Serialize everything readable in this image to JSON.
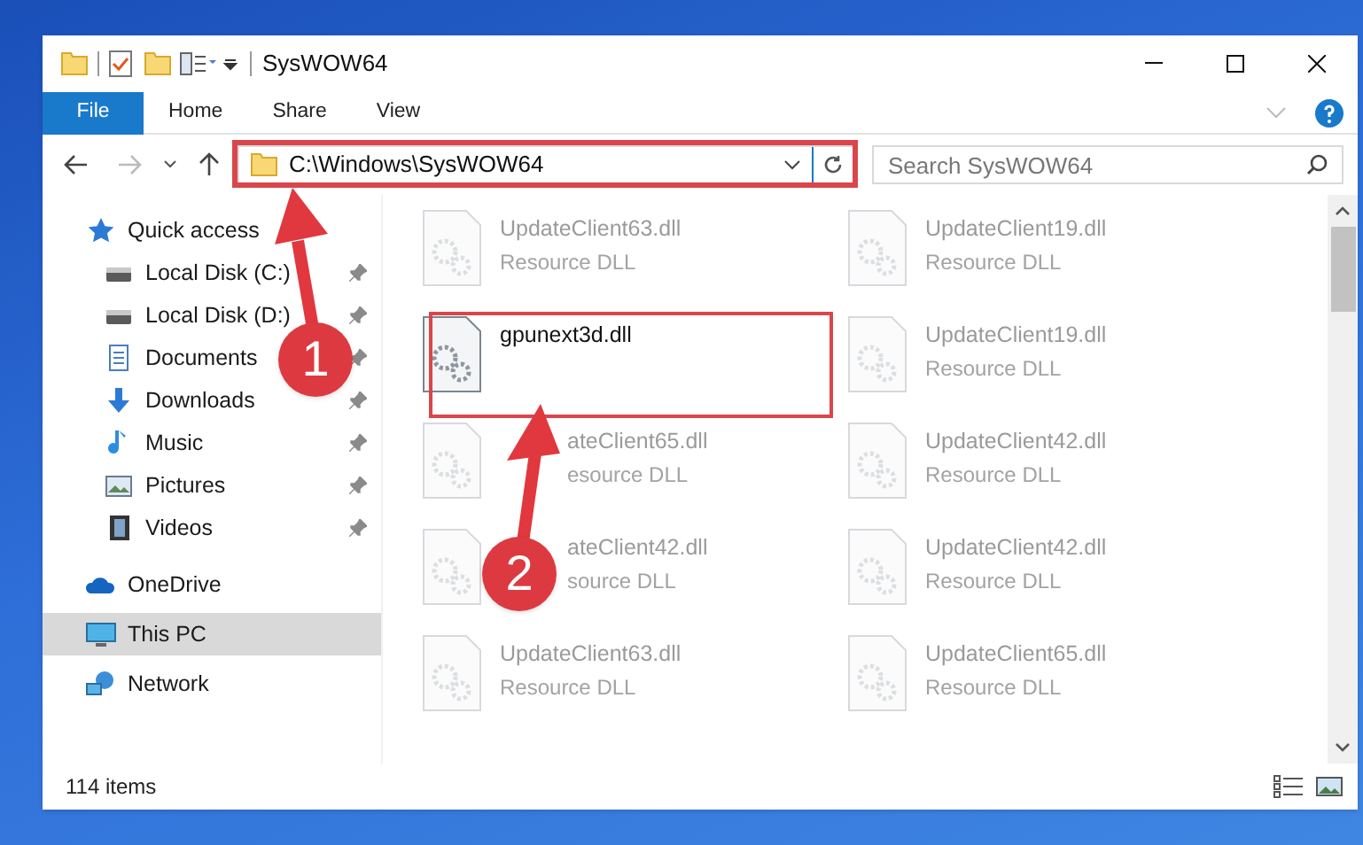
{
  "window": {
    "title": "SysWOW64"
  },
  "ribbon": {
    "tabs": [
      {
        "label": "File",
        "selected": true
      },
      {
        "label": "Home",
        "selected": false
      },
      {
        "label": "Share",
        "selected": false
      },
      {
        "label": "View",
        "selected": false
      }
    ]
  },
  "address_bar": {
    "path": "C:\\Windows\\SysWOW64"
  },
  "search": {
    "placeholder": "Search SysWOW64"
  },
  "sidebar": {
    "items": [
      {
        "label": "Quick access",
        "pinned": false,
        "selected": false,
        "children": [
          {
            "label": "Local Disk (C:)",
            "pinned": true,
            "selected": false
          },
          {
            "label": "Local Disk (D:)",
            "pinned": true,
            "selected": false
          },
          {
            "label": "Documents",
            "pinned": true,
            "selected": false
          },
          {
            "label": "Downloads",
            "pinned": true,
            "selected": false
          },
          {
            "label": "Music",
            "pinned": true,
            "selected": false
          },
          {
            "label": "Pictures",
            "pinned": true,
            "selected": false
          },
          {
            "label": "Videos",
            "pinned": true,
            "selected": false
          }
        ]
      },
      {
        "label": "OneDrive",
        "pinned": false,
        "selected": false
      },
      {
        "label": "This PC",
        "pinned": false,
        "selected": true
      },
      {
        "label": "Network",
        "pinned": false,
        "selected": false
      }
    ]
  },
  "files": [
    {
      "name": "UpdateClient63.dll",
      "type": "Resource DLL",
      "faded": true,
      "covered": false
    },
    {
      "name": "UpdateClient19.dll",
      "type": "Resource DLL",
      "faded": true,
      "covered": false
    },
    {
      "name": "gpunext3d.dll",
      "faded": false,
      "covered": false
    },
    {
      "name": "UpdateClient19.dll",
      "type": "Resource DLL",
      "faded": true,
      "covered": false
    },
    {
      "name": "ateClient65.dll",
      "type": "esource DLL",
      "faded": true,
      "covered": true
    },
    {
      "name": "UpdateClient42.dll",
      "type": "Resource DLL",
      "faded": true,
      "covered": false
    },
    {
      "name": "ateClient42.dll",
      "type": "source DLL",
      "faded": true,
      "covered": true
    },
    {
      "name": "UpdateClient42.dll",
      "type": "Resource DLL",
      "faded": true,
      "covered": false
    },
    {
      "name": "UpdateClient63.dll",
      "type": "Resource DLL",
      "faded": true,
      "covered": false
    },
    {
      "name": "UpdateClient65.dll",
      "type": "Resource DLL",
      "faded": true,
      "covered": false
    }
  ],
  "status_bar": {
    "item_count": "114 items"
  },
  "annotations": [
    {
      "number": "1"
    },
    {
      "number": "2"
    }
  ]
}
